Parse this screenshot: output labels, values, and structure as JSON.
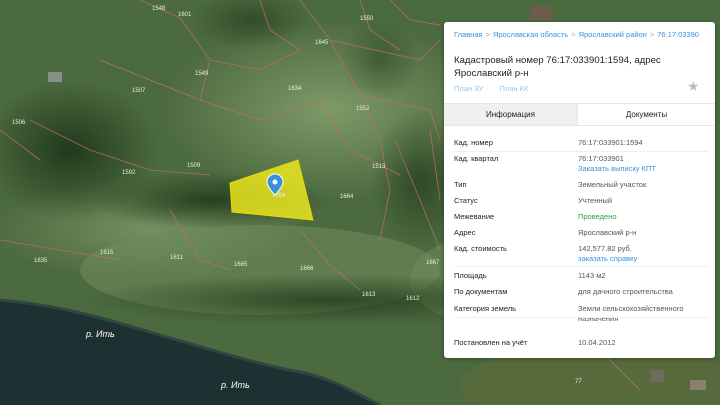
{
  "map": {
    "plot_numbers": [
      {
        "label": "1601"
      },
      {
        "label": "1550"
      },
      {
        "label": "1645"
      },
      {
        "label": "1548"
      },
      {
        "label": "1549"
      },
      {
        "label": "1507"
      },
      {
        "label": "1634"
      },
      {
        "label": "1506"
      },
      {
        "label": "1552"
      },
      {
        "label": "1509"
      },
      {
        "label": "1592"
      },
      {
        "label": "1513"
      },
      {
        "label": "1664"
      },
      {
        "label": "1594"
      },
      {
        "label": "1611"
      },
      {
        "label": "1667"
      },
      {
        "label": "1665"
      },
      {
        "label": "1666"
      },
      {
        "label": "1613"
      },
      {
        "label": "1612"
      },
      {
        "label": "1615"
      },
      {
        "label": "1635"
      },
      {
        "label": "77"
      }
    ],
    "river_labels": [
      "р. Ить",
      "р. Ить"
    ],
    "colors": {
      "selected_plot": "#f5ee1e",
      "plot_border": "#c86a6a",
      "marker": "#3d8fd8"
    }
  },
  "panel": {
    "breadcrumbs": [
      "Главная",
      "Ярославская область",
      "Ярославский район",
      "76:17:03390"
    ],
    "breadcrumb_separator": ">",
    "title": "Кадастровый номер 76:17:033901:1594, адрес Ярославский р-н",
    "plans": [
      "План ЗУ",
      "План КК"
    ],
    "favorite_icon": "star-icon",
    "tabs": [
      "Информация",
      "Документы"
    ],
    "rows": [
      {
        "key": "Кад. номер",
        "value": "76:17:033901:1594"
      },
      {
        "key": "Кад. квартал",
        "value": "76:17:033901",
        "link": "Заказать выписку КПТ"
      },
      {
        "key": "Тип",
        "value": "Земельный участок"
      },
      {
        "key": "Статус",
        "value": "Учтенный"
      },
      {
        "key": "Межевание",
        "value": "Проведено",
        "status": "green"
      },
      {
        "key": "Адрес",
        "value": "Ярославский р-н"
      },
      {
        "key": "Кад. стоимость",
        "value": "142,577.82 руб.",
        "link": "заказать справку"
      },
      {
        "key": "Площадь",
        "value": "1143 м2"
      },
      {
        "key": "По документам",
        "value": "для дачного строительства"
      },
      {
        "key": "Категория земель",
        "value": "Земли сельскохозяйственного назначения"
      },
      {
        "key": "Постановлен на учёт",
        "value": "10.04.2012"
      }
    ]
  }
}
